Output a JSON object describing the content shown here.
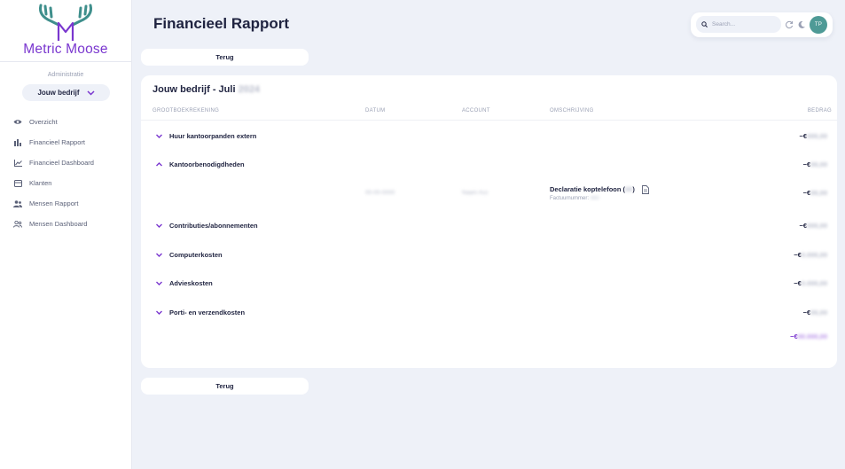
{
  "brand": {
    "name": "Metric Moose",
    "color": "#7a37cf",
    "logo_icon": "moose-antlers-icon"
  },
  "sidebar": {
    "admin_label": "Administratie",
    "company": "Jouw bedrijf",
    "items": [
      {
        "label": "Overzicht",
        "icon": "eye-icon"
      },
      {
        "label": "Financieel Rapport",
        "icon": "bar-chart-icon"
      },
      {
        "label": "Financieel Dashboard",
        "icon": "line-chart-icon"
      },
      {
        "label": "Klanten",
        "icon": "id-card-icon"
      },
      {
        "label": "Mensen Rapport",
        "icon": "users-icon"
      },
      {
        "label": "Mensen Dashboard",
        "icon": "user-group-icon"
      }
    ]
  },
  "header": {
    "title": "Financieel Rapport",
    "search_placeholder": "Search...",
    "avatar_initials": "TP"
  },
  "back_label": "Terug",
  "report": {
    "title": "Jouw bedrijf - Juli",
    "title_year_hidden": "2024",
    "columns": {
      "ledger": "GROOTBOEKREKENING",
      "date": "DATUM",
      "account": "ACCOUNT",
      "description": "OMSCHRIJVING",
      "amount": "BEDRAG"
    },
    "currency_prefix": "−€",
    "rows": [
      {
        "label": "Huur kantoorpanden extern",
        "expanded": false,
        "amount_hidden": "000,00"
      },
      {
        "label": "Kantoorbenodigdheden",
        "expanded": true,
        "amount_hidden": "00,00"
      },
      {
        "label": "Contributies/abonnementen",
        "expanded": false,
        "amount_hidden": "000,00"
      },
      {
        "label": "Computerkosten",
        "expanded": false,
        "amount_hidden": "0.000,00"
      },
      {
        "label": "Advieskosten",
        "expanded": false,
        "amount_hidden": "0.000,00"
      },
      {
        "label": "Porti- en verzendkosten",
        "expanded": false,
        "amount_hidden": "00,00"
      }
    ],
    "detail": {
      "date_hidden": "00-00-0000",
      "account_hidden": "Naam Acc",
      "description": "Declaratie koptelefoon (",
      "description_hidden": "00",
      "description_end": ")",
      "invoice_label": "Factuurnummer:",
      "invoice_hidden": "000",
      "amount_hidden": "00,00"
    },
    "total_hidden": "00.000,00"
  },
  "colors": {
    "accent": "#7a37cf",
    "avatar": "#4e9a96",
    "background": "#eef1f8"
  }
}
